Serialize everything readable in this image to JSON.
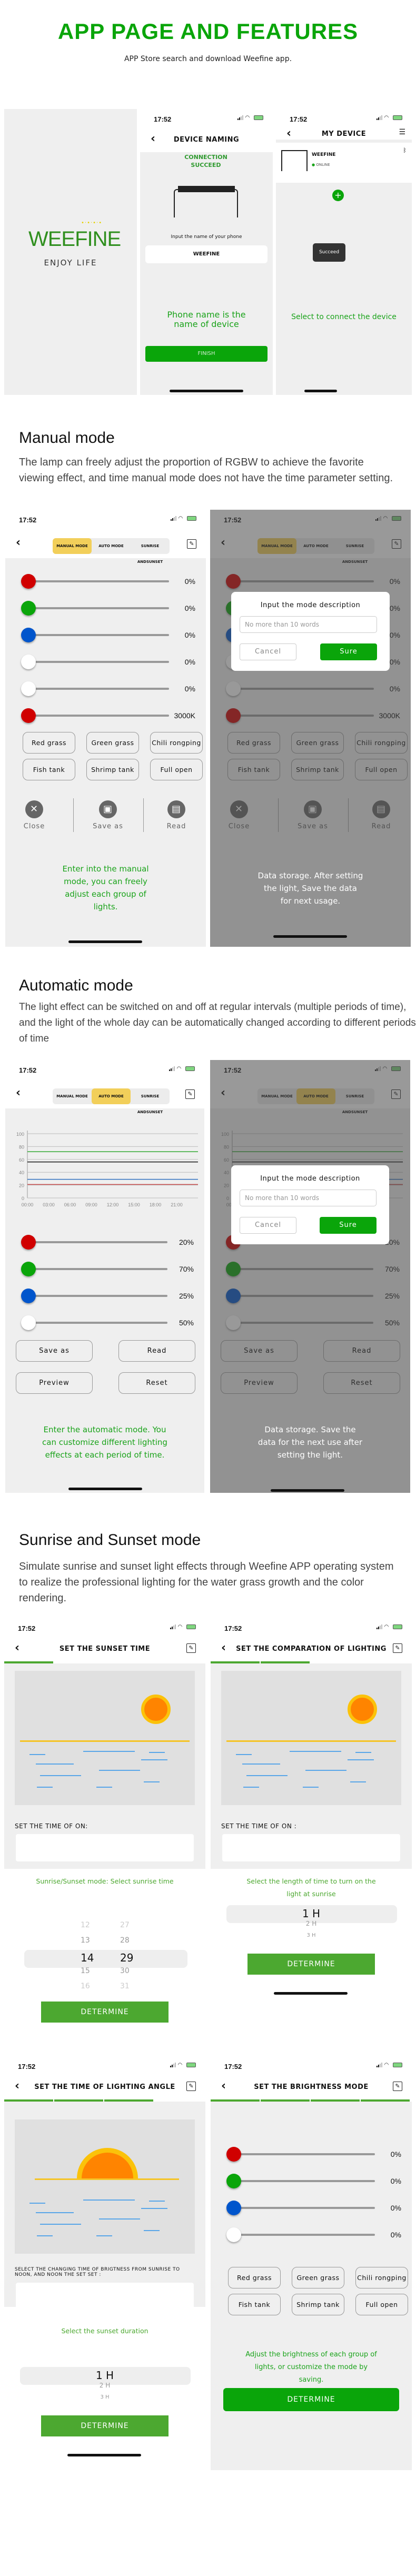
{
  "header": {
    "title": "APP PAGE AND FEATURES",
    "subtitle": "APP Store search and download Weefine app."
  },
  "status_bar": {
    "time": "17:52",
    "location_glyph": "➚"
  },
  "splash": {
    "brand": "WEEFINE",
    "tagline": "ENJOY LIFE",
    "brand_color": "#2f8f1e"
  },
  "device_naming": {
    "title": "DEVICE NAMING",
    "connection_status": "CONNECTION SUCCEED",
    "input_label": "Input the name of your phone",
    "input_value": "WEEFINE",
    "note": "Phone name is the name of device",
    "finish": "FINISH"
  },
  "my_device": {
    "title": "MY DEVICE",
    "device_name": "WEEFINE",
    "device_status": "ONLINE",
    "toast": "Succeed",
    "note": "Select to connect the device"
  },
  "modes": {
    "tabs": [
      "MANUAL MODE",
      "AUTO MODE",
      "SUNRISE ANDSUNSET"
    ]
  },
  "manual_section": {
    "title": "Manual mode",
    "description": "The lamp can freely adjust the proportion of RGBW to achieve the favorite viewing effect, and time manual mode does not have the time parameter setting.",
    "sliders": [
      {
        "color": "#d00000",
        "value": "0%"
      },
      {
        "color": "#0aa50a",
        "value": "0%"
      },
      {
        "color": "#0055cc",
        "value": "0%"
      },
      {
        "color": "#ffffff",
        "value": "0%"
      },
      {
        "color": "#ffffff",
        "value": "0%"
      },
      {
        "color": "#d00000",
        "value": "3000K"
      }
    ],
    "presets": [
      "Red grass",
      "Green grass",
      "Chili rongping",
      "Fish tank",
      "Shrimp tank",
      "Full open"
    ],
    "actions": [
      {
        "label": "Close",
        "icon": "close-icon",
        "glyph": "✕"
      },
      {
        "label": "Save as",
        "icon": "save-icon",
        "glyph": "▣"
      },
      {
        "label": "Read",
        "icon": "read-icon",
        "glyph": "▤"
      }
    ],
    "left_note": "Enter into the manual mode, you can freely adjust each group of lights.",
    "right_note": "Data storage. After setting the light, Save the data for next usage."
  },
  "dialog": {
    "title": "Input the mode description",
    "placeholder": "No more than 10 words",
    "cancel": "Cancel",
    "sure": "Sure"
  },
  "auto_section": {
    "title": "Automatic mode",
    "description": "The light effect can be switched on and off at regular intervals (multiple periods of time), and the light of the whole day can be automatically changed according to different periods of time",
    "sliders": [
      {
        "color": "#d00000",
        "value": "20%"
      },
      {
        "color": "#0aa50a",
        "value": "70%"
      },
      {
        "color": "#0055cc",
        "value": "25%"
      },
      {
        "color": "#ffffff",
        "value": "50%"
      }
    ],
    "buttons": [
      "Save as",
      "Read",
      "Preview",
      "Reset"
    ],
    "left_note": "Enter the automatic mode. You can customize different lighting effects at each period of time.",
    "right_note": "Data storage. Save the data for the next use after setting the light."
  },
  "chart_data": {
    "type": "line",
    "title": "",
    "xlabel": "",
    "ylabel": "",
    "x": [
      "00:00",
      "03:00",
      "06:00",
      "09:00",
      "12:00",
      "15:00",
      "18:00",
      "21:00"
    ],
    "ylim": [
      0,
      100
    ],
    "yticks": [
      0,
      20,
      40,
      60,
      80,
      100
    ],
    "grid": true,
    "series": [
      {
        "name": "green",
        "color": "#33aa33",
        "values": [
          72,
          72,
          72,
          72,
          72,
          72,
          72,
          72
        ]
      },
      {
        "name": "white",
        "color": "#111111",
        "values": [
          56,
          56,
          56,
          56,
          56,
          56,
          56,
          56
        ]
      },
      {
        "name": "blue",
        "color": "#2e6fbf",
        "values": [
          29,
          29,
          29,
          29,
          29,
          29,
          29,
          29
        ]
      },
      {
        "name": "red",
        "color": "#c84c4c",
        "values": [
          21,
          21,
          21,
          21,
          21,
          21,
          21,
          21
        ]
      }
    ]
  },
  "sunrise_section": {
    "title": "Sunrise and Sunset mode",
    "description": "Simulate sunrise and sunset light effects through Weefine APP operating system to realize the professional lighting for the water grass growth and the color rendering.",
    "screens": [
      {
        "title": "SET THE SUNSET TIME",
        "steps_done": 1,
        "label": "SET THE TIME OF ON:",
        "note": "Sunrise/Sunset mode: Select sunrise time",
        "picker_hours": [
          "12",
          "13",
          "14",
          "15",
          "16"
        ],
        "picker_minutes": [
          "27",
          "28",
          "29",
          "30",
          "31"
        ],
        "selected": "14:29",
        "button": "DETERMINE"
      },
      {
        "title": "SET THE COMPARATION OF LIGHTING",
        "steps_done": 2,
        "label": "SET THE TIME OF ON :",
        "note": "Select the length of time to turn on the light at sunrise",
        "picker": [
          "1 H",
          "2 H",
          "3 H"
        ],
        "button": "DETERMINE"
      },
      {
        "title": "SET THE TIME OF LIGHTING ANGLE",
        "steps_done": 3,
        "label": "SELECT THE CHANGING TIME OF BRIGTNESS FROM SUNRISE TO NOON, AND NOON THE SET SET :",
        "note": "Select the sunset duration",
        "picker": [
          "1 H",
          "2 H",
          "3 H"
        ],
        "button": "DETERMINE"
      },
      {
        "title": "SET THE BRIGHTNESS MODE",
        "steps_done": 4,
        "sliders": [
          {
            "color": "#d00000",
            "value": "0%"
          },
          {
            "color": "#0aa50a",
            "value": "0%"
          },
          {
            "color": "#0055cc",
            "value": "0%"
          },
          {
            "color": "#ffffff",
            "value": "0%"
          }
        ],
        "presets": [
          "Red grass",
          "Green grass",
          "Chili rongping",
          "Fish tank",
          "Shrimp tank",
          "Full open"
        ],
        "note": "Adjust the brightness of each group of lights, or customize the mode by saving.",
        "button": "DETERMINE"
      }
    ]
  }
}
